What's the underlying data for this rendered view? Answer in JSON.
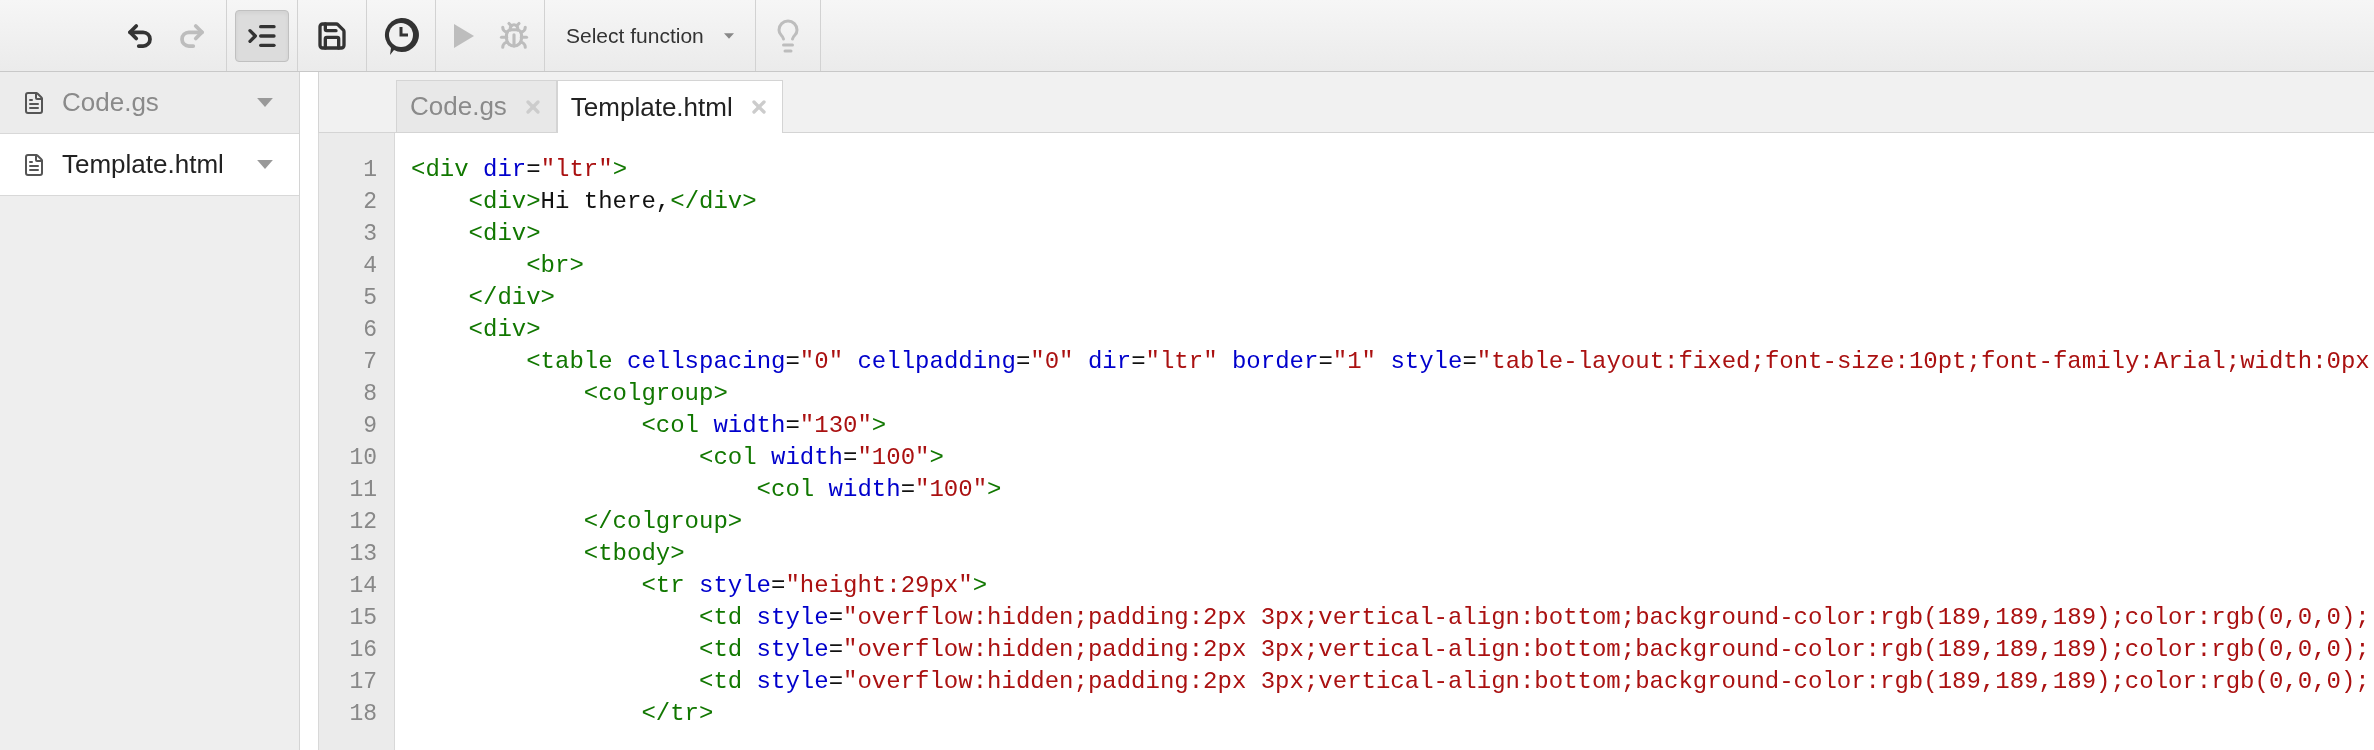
{
  "toolbar": {
    "groups": [
      [
        {
          "kind": "undo",
          "disabled": false,
          "selected": false
        },
        {
          "kind": "redo",
          "disabled": true,
          "selected": false
        }
      ],
      [
        {
          "kind": "indent",
          "disabled": false,
          "selected": true
        }
      ],
      [
        {
          "kind": "save",
          "disabled": false,
          "selected": false
        }
      ],
      [
        {
          "kind": "triggers",
          "disabled": false,
          "selected": false
        }
      ],
      [
        {
          "kind": "run",
          "disabled": true,
          "selected": false
        },
        {
          "kind": "debug",
          "disabled": true,
          "selected": false
        }
      ],
      [
        {
          "kind": "function_select",
          "label": "Select function",
          "disabled": false,
          "selected": false
        }
      ],
      [
        {
          "kind": "hint",
          "disabled": true,
          "selected": false
        }
      ]
    ]
  },
  "sidebar": {
    "files": [
      {
        "name": "Code.gs",
        "selected": false
      },
      {
        "name": "Template.html",
        "selected": true
      }
    ]
  },
  "tabs": [
    {
      "label": "Code.gs",
      "selected": false
    },
    {
      "label": "Template.html",
      "selected": true
    }
  ],
  "code": [
    {
      "number": "1",
      "tokens": [
        {
          "kind": "tag",
          "text": "<div"
        },
        {
          "kind": "attr",
          "text": " dir"
        },
        {
          "kind": "plain",
          "text": "="
        },
        {
          "kind": "value",
          "text": "\"ltr\""
        },
        {
          "kind": "tag",
          "text": ">"
        }
      ],
      "children": [
        {
          "number": "2",
          "tokens": [
            {
              "kind": "tag",
              "text": "<div>"
            },
            {
              "kind": "plain",
              "text": "Hi there,"
            },
            {
              "kind": "tag",
              "text": "</div>"
            }
          ]
        },
        {
          "number": "3",
          "tokens": [
            {
              "kind": "tag",
              "text": "<div>"
            }
          ],
          "children": [
            {
              "number": "4",
              "tokens": [
                {
                  "kind": "tag",
                  "text": "<br>"
                }
              ]
            }
          ]
        },
        {
          "number": "5",
          "tokens": [
            {
              "kind": "tag",
              "text": "</div>"
            }
          ]
        },
        {
          "number": "6",
          "tokens": [
            {
              "kind": "tag",
              "text": "<div>"
            }
          ],
          "children": [
            {
              "number": "7",
              "tokens": [
                {
                  "kind": "tag",
                  "text": "<table"
                },
                {
                  "kind": "attr",
                  "text": " cellspacing"
                },
                {
                  "kind": "plain",
                  "text": "="
                },
                {
                  "kind": "value",
                  "text": "\"0\""
                },
                {
                  "kind": "attr",
                  "text": " cellpadding"
                },
                {
                  "kind": "plain",
                  "text": "="
                },
                {
                  "kind": "value",
                  "text": "\"0\""
                },
                {
                  "kind": "attr",
                  "text": " dir"
                },
                {
                  "kind": "plain",
                  "text": "="
                },
                {
                  "kind": "value",
                  "text": "\"ltr\""
                },
                {
                  "kind": "attr",
                  "text": " border"
                },
                {
                  "kind": "plain",
                  "text": "="
                },
                {
                  "kind": "value",
                  "text": "\"1\""
                },
                {
                  "kind": "attr",
                  "text": " style"
                },
                {
                  "kind": "plain",
                  "text": "="
                },
                {
                  "kind": "value",
                  "text": "\"table-layout:fixed;font-size:10pt;font-family:Arial;width:0px"
                }
              ],
              "children": [
                {
                  "number": "8",
                  "tokens": [
                    {
                      "kind": "tag",
                      "text": "<colgroup>"
                    }
                  ],
                  "children": [
                    {
                      "number": "9",
                      "tokens": [
                        {
                          "kind": "tag",
                          "text": "<col"
                        },
                        {
                          "kind": "attr",
                          "text": " width"
                        },
                        {
                          "kind": "plain",
                          "text": "="
                        },
                        {
                          "kind": "value",
                          "text": "\"130\""
                        },
                        {
                          "kind": "tag",
                          "text": ">"
                        }
                      ],
                      "children": [
                        {
                          "number": "10",
                          "tokens": [
                            {
                              "kind": "tag",
                              "text": "<col"
                            },
                            {
                              "kind": "attr",
                              "text": " width"
                            },
                            {
                              "kind": "plain",
                              "text": "="
                            },
                            {
                              "kind": "value",
                              "text": "\"100\""
                            },
                            {
                              "kind": "tag",
                              "text": ">"
                            }
                          ],
                          "children": [
                            {
                              "number": "11",
                              "tokens": [
                                {
                                  "kind": "tag",
                                  "text": "<col"
                                },
                                {
                                  "kind": "attr",
                                  "text": " width"
                                },
                                {
                                  "kind": "plain",
                                  "text": "="
                                },
                                {
                                  "kind": "value",
                                  "text": "\"100\""
                                },
                                {
                                  "kind": "tag",
                                  "text": ">"
                                }
                              ]
                            }
                          ]
                        }
                      ]
                    }
                  ]
                },
                {
                  "number": "12",
                  "tokens": [
                    {
                      "kind": "tag",
                      "text": "</colgroup>"
                    }
                  ]
                },
                {
                  "number": "13",
                  "tokens": [
                    {
                      "kind": "tag",
                      "text": "<tbody>"
                    }
                  ],
                  "children": [
                    {
                      "number": "14",
                      "tokens": [
                        {
                          "kind": "tag",
                          "text": "<tr"
                        },
                        {
                          "kind": "attr",
                          "text": " style"
                        },
                        {
                          "kind": "plain",
                          "text": "="
                        },
                        {
                          "kind": "value",
                          "text": "\"height:29px\""
                        },
                        {
                          "kind": "tag",
                          "text": ">"
                        }
                      ],
                      "children": [
                        {
                          "number": "15",
                          "tokens": [
                            {
                              "kind": "tag",
                              "text": "<td"
                            },
                            {
                              "kind": "attr",
                              "text": " style"
                            },
                            {
                              "kind": "plain",
                              "text": "="
                            },
                            {
                              "kind": "value",
                              "text": "\"overflow:hidden;padding:2px 3px;vertical-align:bottom;background-color:rgb(189,189,189);color:rgb(0,0,0);"
                            }
                          ]
                        },
                        {
                          "number": "16",
                          "tokens": [
                            {
                              "kind": "tag",
                              "text": "<td"
                            },
                            {
                              "kind": "attr",
                              "text": " style"
                            },
                            {
                              "kind": "plain",
                              "text": "="
                            },
                            {
                              "kind": "value",
                              "text": "\"overflow:hidden;padding:2px 3px;vertical-align:bottom;background-color:rgb(189,189,189);color:rgb(0,0,0);"
                            }
                          ]
                        },
                        {
                          "number": "17",
                          "tokens": [
                            {
                              "kind": "tag",
                              "text": "<td"
                            },
                            {
                              "kind": "attr",
                              "text": " style"
                            },
                            {
                              "kind": "plain",
                              "text": "="
                            },
                            {
                              "kind": "value",
                              "text": "\"overflow:hidden;padding:2px 3px;vertical-align:bottom;background-color:rgb(189,189,189);color:rgb(0,0,0);"
                            }
                          ]
                        }
                      ]
                    },
                    {
                      "number": "18",
                      "tokens": [
                        {
                          "kind": "tag",
                          "text": "</tr>"
                        }
                      ]
                    }
                  ]
                }
              ]
            }
          ]
        }
      ]
    }
  ]
}
